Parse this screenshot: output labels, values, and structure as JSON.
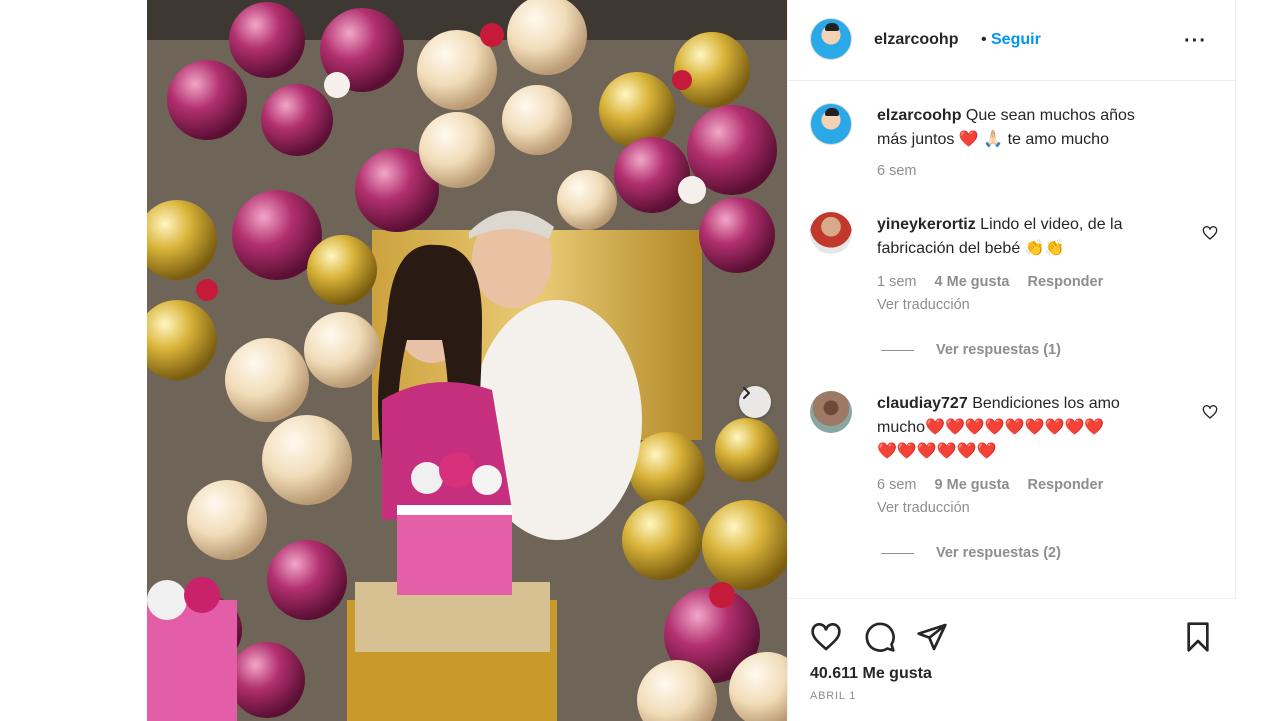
{
  "post": {
    "next_icon": "chevron-right-icon"
  },
  "header": {
    "username": "elzarcoohp",
    "separator": "•",
    "follow_label": "Seguir",
    "more_label": "···"
  },
  "caption": {
    "username": "elzarcoohp",
    "text_line1": "Que sean muchos años",
    "text_line2": "más juntos",
    "emoji1": "❤️",
    "emoji2": "🙏🏻",
    "text_end": "te amo mucho",
    "time": "6 sem"
  },
  "comments": [
    {
      "username": "yineykerortiz",
      "text_line1": "Lindo el video, de la",
      "text_line2": "fabricación del bebé",
      "emojis": "👏👏",
      "time": "1 sem",
      "likes": "4 Me gusta",
      "reply_label": "Responder",
      "translate_label": "Ver traducción",
      "view_replies": "Ver respuestas (1)"
    },
    {
      "username": "claudiay727",
      "text_line1": "Bendiciones los amo",
      "text_line2": "mucho",
      "emojis_line1": "❤️❤️❤️❤️❤️❤️❤️❤️❤️",
      "emojis_line2": "❤️❤️❤️❤️❤️❤️",
      "time": "6 sem",
      "likes": "9 Me gusta",
      "reply_label": "Responder",
      "translate_label": "Ver traducción",
      "view_replies": "Ver respuestas (2)"
    }
  ],
  "actions": {
    "like_icon": "heart-icon",
    "comment_icon": "comment-icon",
    "share_icon": "share-icon",
    "save_icon": "bookmark-icon",
    "likes_count": "40.611 Me gusta",
    "date": "ABRIL 1"
  },
  "colors": {
    "accent": "#0095f6",
    "muted": "#8e8e8e",
    "text": "#262626",
    "heart_red": "#e0245e"
  }
}
